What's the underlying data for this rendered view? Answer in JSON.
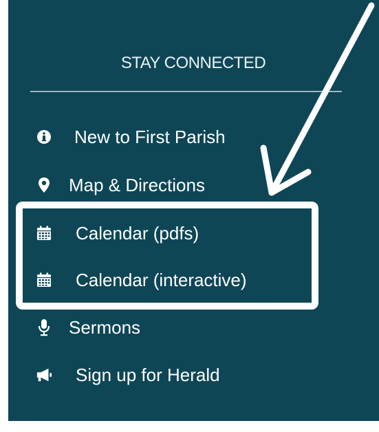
{
  "section": {
    "heading": "STAY CONNECTED"
  },
  "menu": {
    "items": [
      {
        "label": "New to First Parish",
        "icon": "info-circle-icon"
      },
      {
        "label": "Map & Directions",
        "icon": "map-marker-icon"
      },
      {
        "label": "Calendar (pdfs)",
        "icon": "calendar-icon"
      },
      {
        "label": "Calendar (interactive)",
        "icon": "calendar-icon"
      },
      {
        "label": "Sermons",
        "icon": "microphone-icon"
      },
      {
        "label": "Sign up for Herald",
        "icon": "megaphone-icon"
      }
    ]
  },
  "colors": {
    "panel": "#0e4656",
    "text": "#ffffff",
    "annotation": "#ffffff"
  }
}
